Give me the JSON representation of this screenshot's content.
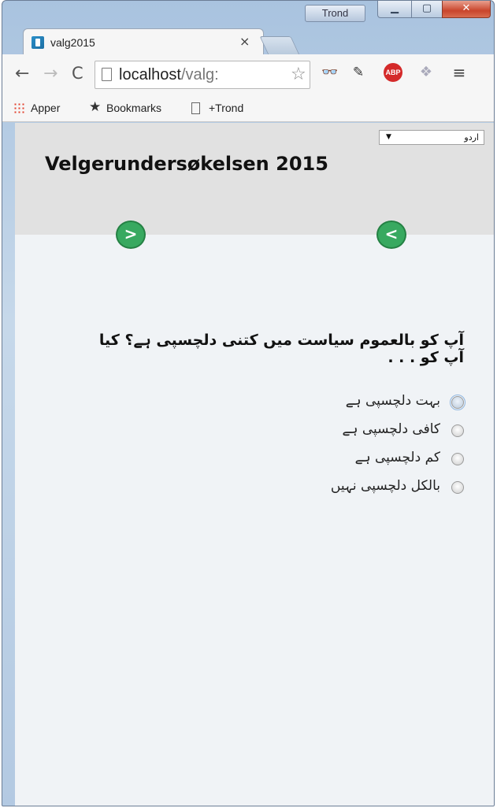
{
  "window": {
    "user_badge": "Trond"
  },
  "tab": {
    "title": "valg2015",
    "close": "×"
  },
  "toolbar": {
    "back": "←",
    "forward": "→",
    "reload": "C",
    "url_host": "localhost",
    "url_path": "/valg:",
    "star": "☆",
    "menu": "≡",
    "abp": "ABP"
  },
  "bookmarks": {
    "apps": "Apper",
    "bookmarks": "Bookmarks",
    "trond": "+Trond"
  },
  "page": {
    "language": {
      "selected": "اردو"
    },
    "title": "Velgerundersøkelsen 2015",
    "nav": {
      "prev": ">",
      "next": "<"
    },
    "question": "آپ کو بالعموم سیاست میں کتنی دلچسپی ہے؟ کیا آپ کو . . .",
    "options": [
      "بہت دلچسپی ہے",
      "کافی دلچسپی ہے",
      "کم دلچسپی ہے",
      "بالکل دلچسپی نہیں"
    ]
  },
  "colors": {
    "nav_button": "#38a960",
    "header_bg": "#e1e1e1",
    "page_bg": "#f0f3f6"
  },
  "icons": [
    "user-badge",
    "minimize-icon",
    "maximize-icon",
    "close-icon",
    "favicon",
    "back-arrow-icon",
    "forward-arrow-icon",
    "reload-icon",
    "page-icon",
    "star-icon",
    "glasses-icon",
    "pipette-icon",
    "adblock-icon",
    "dropbox-icon",
    "menu-icon",
    "apps-icon",
    "bookmark-star-icon",
    "document-icon"
  ]
}
